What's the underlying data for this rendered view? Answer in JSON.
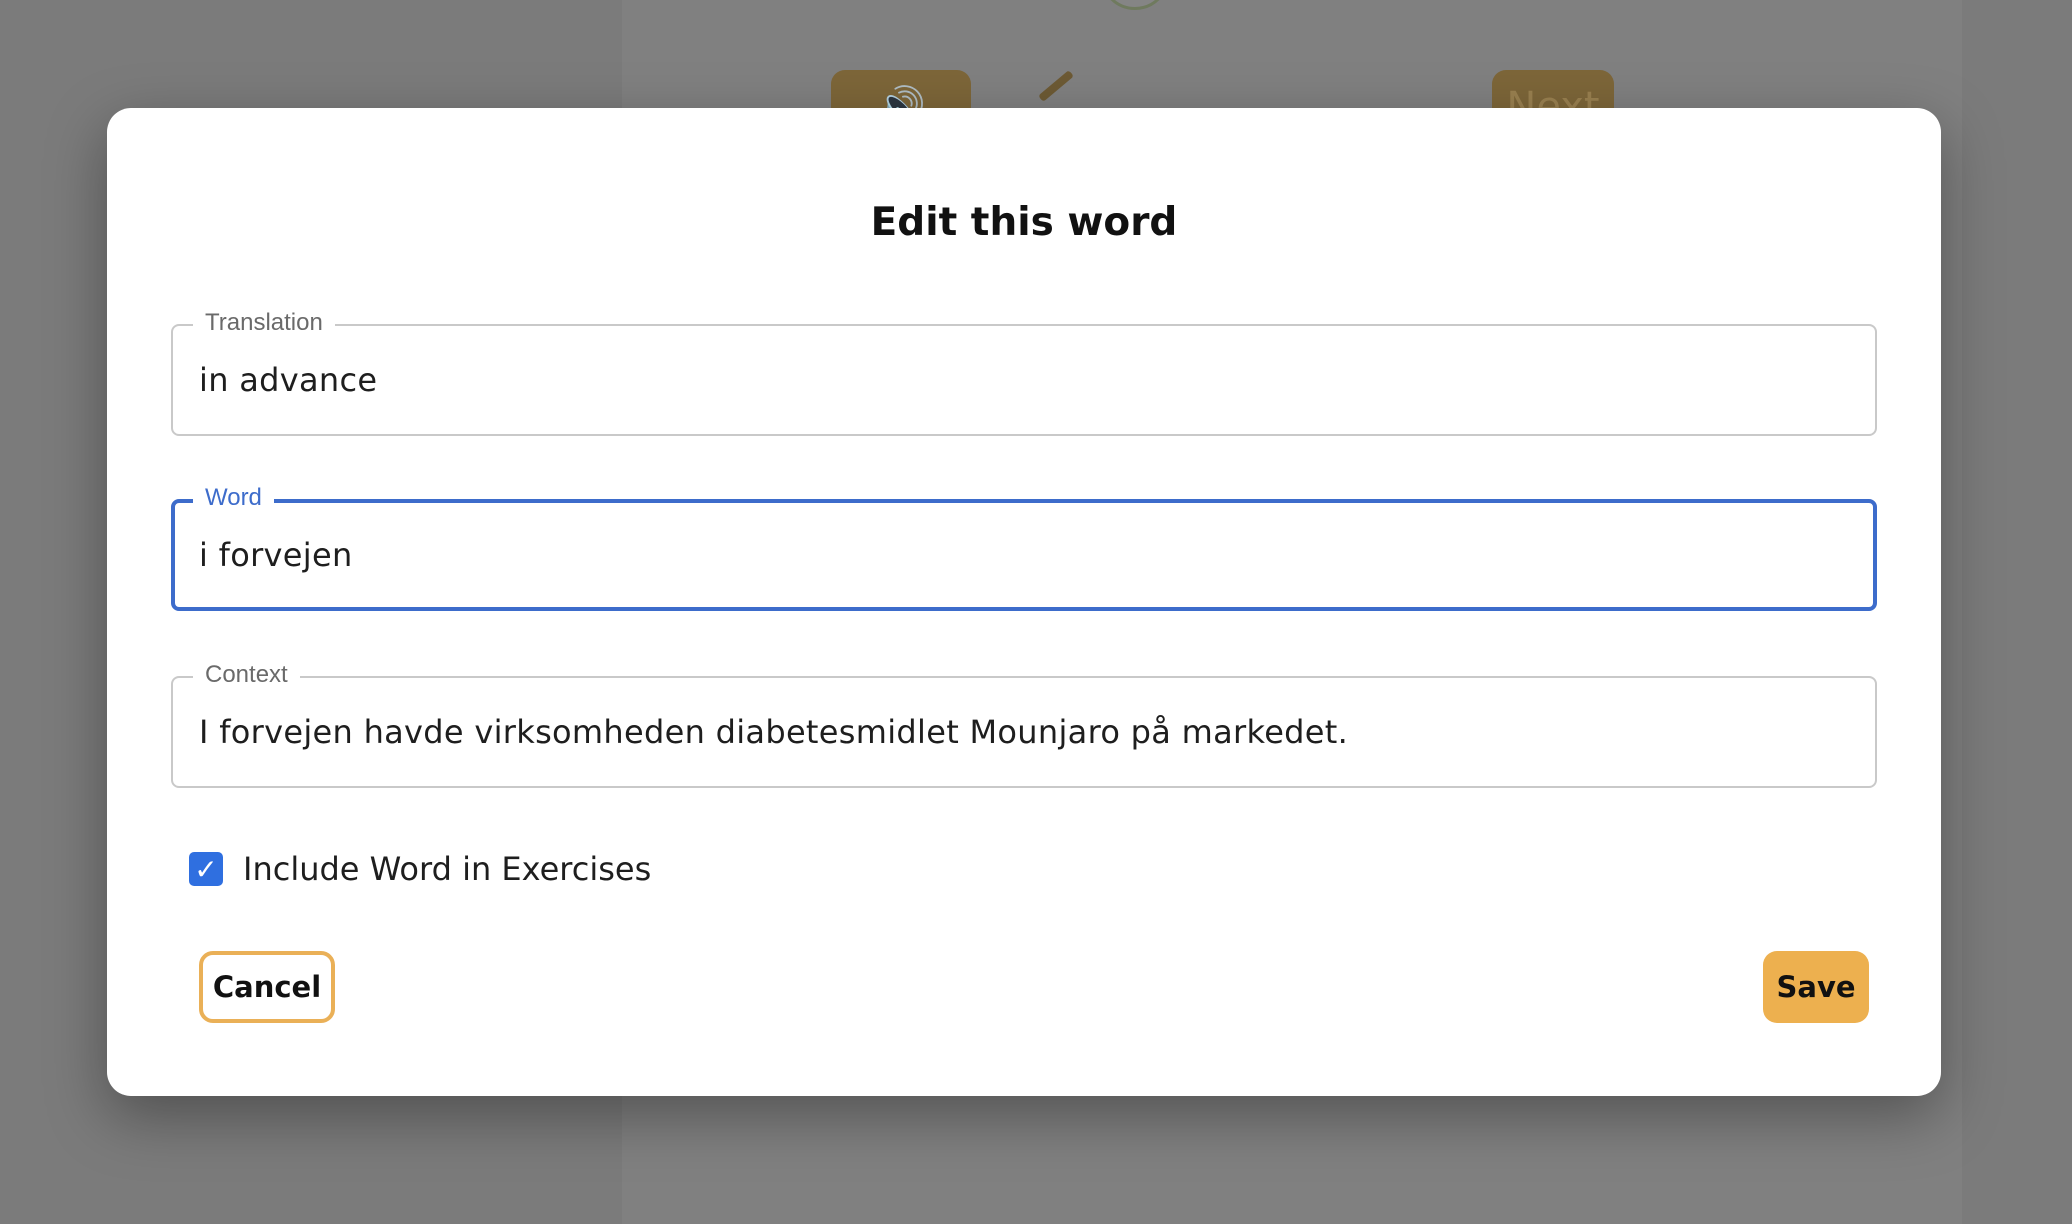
{
  "background": {
    "next_label": "Next"
  },
  "modal": {
    "title": "Edit this word",
    "fields": {
      "translation": {
        "label": "Translation",
        "value": "in advance"
      },
      "word": {
        "label": "Word",
        "value": "i forvejen"
      },
      "context": {
        "label": "Context",
        "value": "I forvejen havde virksomheden diabetesmidlet Mounjaro på markedet."
      }
    },
    "include_checkbox": {
      "label": "Include Word in Exercises",
      "checked": true
    },
    "cancel_label": "Cancel",
    "save_label": "Save"
  },
  "colors": {
    "accent": "#edb04f",
    "focus": "#3d6ccb",
    "checkbox": "#2f6fe0"
  },
  "icons": {
    "background_speaker": "speaker-icon",
    "background_pencil": "pencil-icon",
    "checkbox": "checkmark-icon"
  }
}
